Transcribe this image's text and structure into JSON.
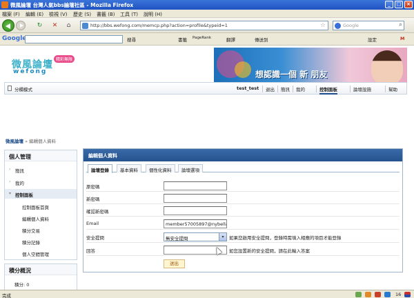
{
  "window": {
    "title": "微風論壇 台灣人氣bbs論壇社區 - Mozilla Firefox",
    "min_label": "_",
    "max_label": "□",
    "close_label": "×"
  },
  "menu": [
    "檔案 (F)",
    "編輯 (E)",
    "檢視 (V)",
    "歷史 (S)",
    "書籤 (B)",
    "工具 (T)",
    "說明 (H)"
  ],
  "nav": {
    "reload": "↻",
    "stop": "✕",
    "home": "⌂",
    "url": "http://bbs.wefong.com/memcp.php?action=profile&typeid=1",
    "search_placeholder": "Google"
  },
  "google_toolbar": {
    "logo": "Google",
    "search": "搜尋",
    "bookmarks": "書籤",
    "pagerank": "PageRank",
    "translate": "翻譯",
    "sendto": "傳送到",
    "settings": "設定",
    "mail": "M"
  },
  "site": {
    "logo_cn": "微風論壇",
    "logo_en": "wefong",
    "logo_badge": "精彩無限",
    "banner_text": "想認識一個 新 朋友"
  },
  "navstrip": {
    "switch_label": "分欄模式",
    "user": "test_test",
    "links": [
      "退出",
      "簡訊",
      "我的",
      "控制面板",
      "論壇設施",
      "幫助"
    ]
  },
  "breadcrumb": {
    "home": "微風論壇",
    "sep": " » ",
    "current": "編輯個人資料"
  },
  "sidebar": {
    "title": "個人管理",
    "items": [
      {
        "label": "簡訊",
        "arrow": "›"
      },
      {
        "label": "我的",
        "arrow": "›"
      },
      {
        "label": "控制面板",
        "arrow": "▾"
      },
      {
        "label": "控制面板首頁",
        "arrow": ""
      },
      {
        "label": "編輯個人資料",
        "arrow": ""
      },
      {
        "label": "積分交易",
        "arrow": ""
      },
      {
        "label": "積分記錄",
        "arrow": ""
      },
      {
        "label": "個人空間管理",
        "arrow": ""
      }
    ],
    "points_title": "積分概況",
    "points_line": "積分: 0"
  },
  "panel": {
    "title": "編輯個人資料",
    "tabs": [
      "論壇登錄",
      "基本資料",
      "個性化資料",
      "論壇選項"
    ],
    "fields": [
      {
        "label": "原密碼",
        "value": "",
        "hint": ""
      },
      {
        "label": "新密碼",
        "value": "",
        "hint": ""
      },
      {
        "label": "確認新密碼",
        "value": "",
        "hint": ""
      },
      {
        "label": "Email",
        "value": "member57005897@nybella.com",
        "hint": ""
      },
      {
        "label": "安全提問",
        "value": "無安全提問",
        "hint": "如果您啟用安全提問，登錄時需填入相應的項目才能登錄"
      },
      {
        "label": "回答",
        "value": "",
        "hint": "如您設置新的安全提問，請在此輸入答案"
      }
    ],
    "submit": "送出"
  },
  "status": {
    "text": "完成",
    "count": "16"
  }
}
